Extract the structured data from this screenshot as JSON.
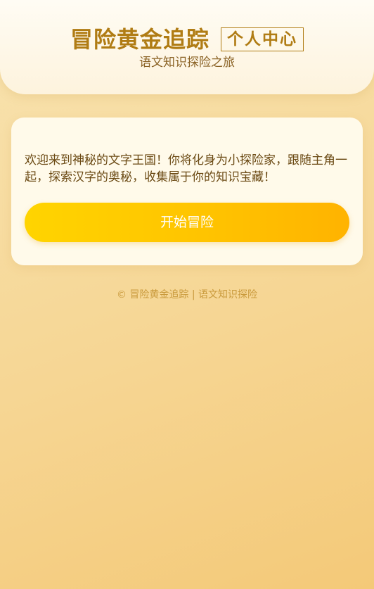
{
  "header": {
    "title": "冒险黄金追踪",
    "profile_button": "个人中心",
    "subtitle": "语文知识探险之旅"
  },
  "card": {
    "intro": "欢迎来到神秘的文字王国！你将化身为小探险家，跟随主角一起，探索汉字的奥秘，收集属于你的知识宝藏！",
    "start_button": "开始冒险"
  },
  "footer": {
    "text": "© 冒险黄金追踪 | 语文知识探险"
  }
}
